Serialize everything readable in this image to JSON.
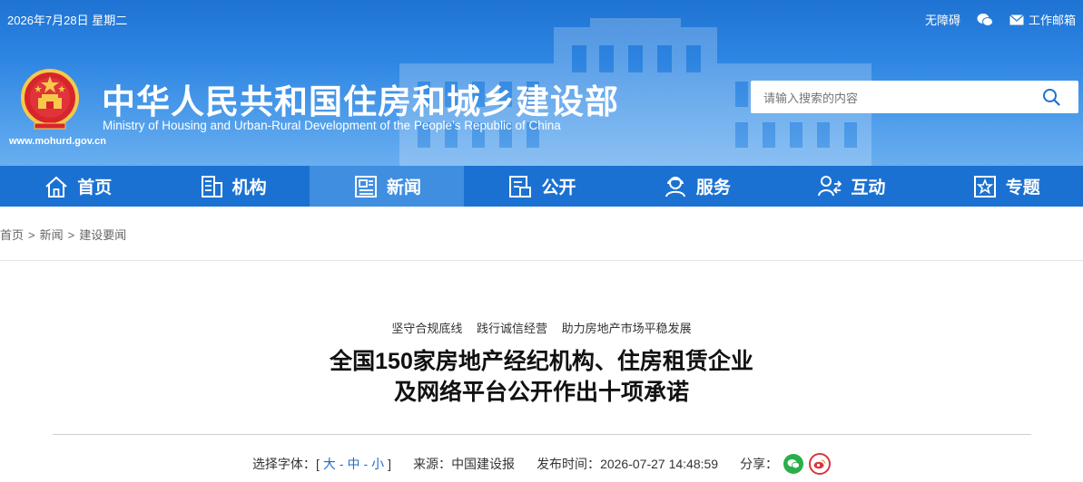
{
  "topbar": {
    "date": "2026年7月28日 星期二",
    "accessibility": "无障碍",
    "wechat_icon": "wechat-icon",
    "mail": "工作邮箱"
  },
  "header": {
    "title_cn": "中华人民共和国住房和城乡建设部",
    "title_en": "Ministry of Housing and Urban-Rural Development of the People’s Republic of China",
    "site_url": "www.mohurd.gov.cn",
    "emblem_icon": "national-emblem-icon"
  },
  "search": {
    "placeholder": "请输入搜索的内容",
    "icon": "search-icon"
  },
  "nav": {
    "items": [
      {
        "label": "首页",
        "icon": "home-icon"
      },
      {
        "label": "机构",
        "icon": "building-icon"
      },
      {
        "label": "新闻",
        "icon": "newspaper-icon",
        "active": true
      },
      {
        "label": "公开",
        "icon": "document-icon"
      },
      {
        "label": "服务",
        "icon": "service-icon"
      },
      {
        "label": "互动",
        "icon": "interact-icon"
      },
      {
        "label": "专题",
        "icon": "star-box-icon"
      }
    ]
  },
  "breadcrumb": {
    "home": "首页",
    "sep": ">",
    "news": "新闻",
    "current": "建设要闻"
  },
  "article": {
    "subtitle": [
      "坚守合规底线",
      "践行诚信经营",
      "助力房地产市场平稳发展"
    ],
    "title_line1": "全国150家房地产经纪机构、住房租赁企业",
    "title_line2": "及网络平台公开作出十项承诺",
    "font_label": "选择字体：",
    "font_open": "[",
    "font_large": "大",
    "font_dash": "-",
    "font_medium": "中",
    "font_small": "小",
    "font_close": "]",
    "source_label": "来源：",
    "source": "中国建设报",
    "time_label": "发布时间：",
    "time": "2026-07-27 14:48:59",
    "share_label": "分享："
  },
  "colors": {
    "header_blue": "#1f73d2",
    "nav_blue": "#1b71d2",
    "nav_active": "#3f8ee0",
    "link_blue": "#1f6bc8"
  }
}
